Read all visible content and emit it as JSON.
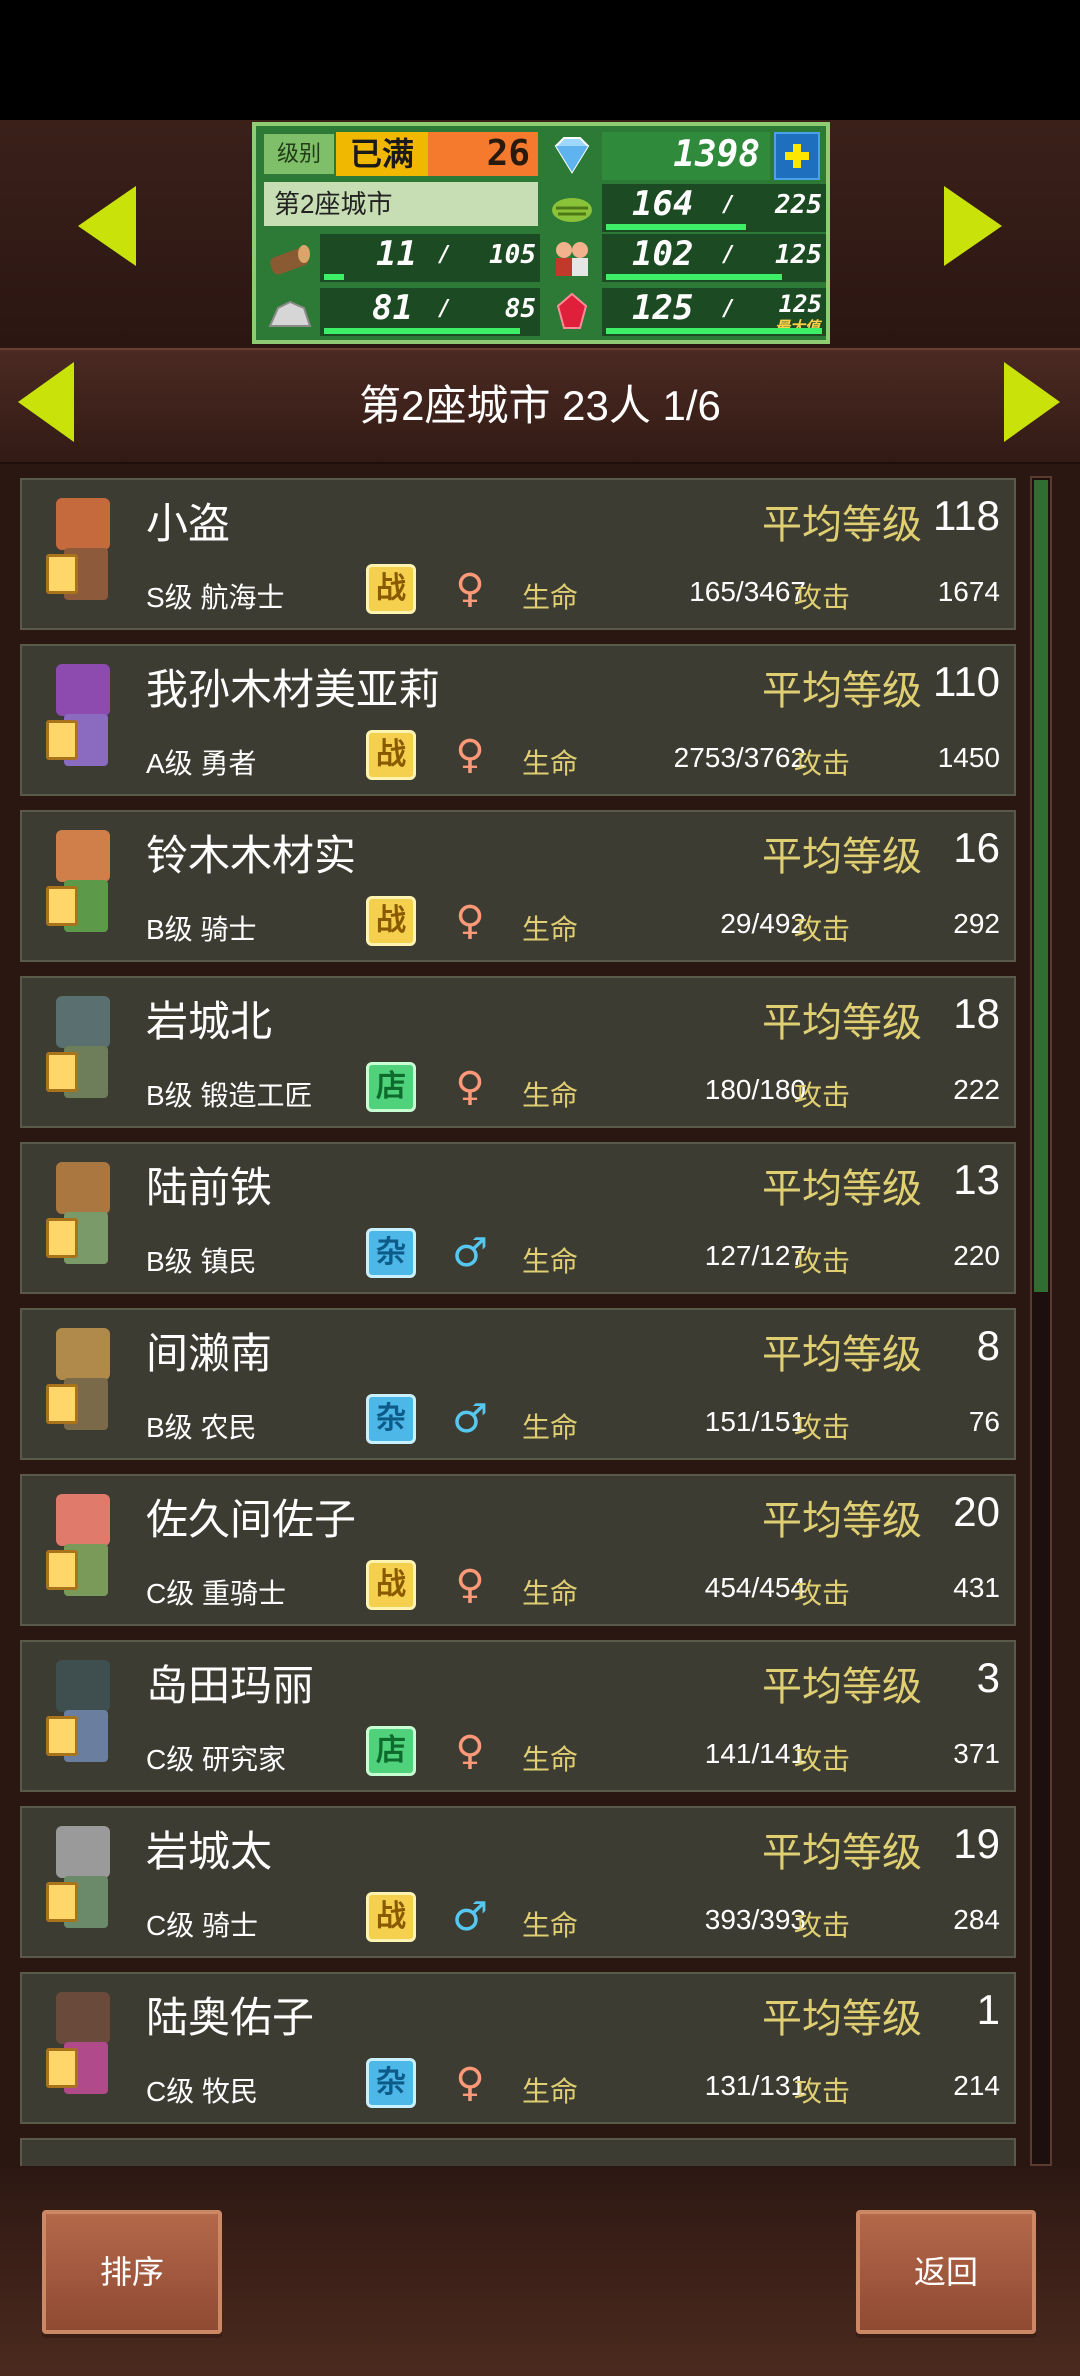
{
  "hud": {
    "level_label": "级别",
    "level_max": "已满",
    "level_value": "26",
    "gems": "1398",
    "city_name": "第2座城市",
    "food_value": "164",
    "food_max": "225",
    "wood_value": "11",
    "wood_max": "105",
    "pop_value": "102",
    "pop_max": "125",
    "stone_value": "81",
    "stone_max": "85",
    "ruby_value": "125",
    "ruby_max": "125",
    "max_tag": "最大值"
  },
  "header": {
    "title": "第2座城市  23人 1/6"
  },
  "columns": {
    "avg_level_label": "平均等级",
    "hp_label": "生命",
    "attack_label": "攻击"
  },
  "residents": [
    {
      "name": "小盗",
      "rank": "S级 航海士",
      "job_type": "战",
      "job_kind": "battle",
      "gender": "female",
      "hp": "165/3467",
      "attack": "1674",
      "level": "118",
      "head": "#c56a3c",
      "body": "#8d5a3b"
    },
    {
      "name": "我孙木材美亚莉",
      "rank": "A级 勇者",
      "job_type": "战",
      "job_kind": "battle",
      "gender": "female",
      "hp": "2753/3762",
      "attack": "1450",
      "level": "110",
      "head": "#8d4bb0",
      "body": "#8a6bbf"
    },
    {
      "name": "铃木木材实",
      "rank": "B级 骑士",
      "job_type": "战",
      "job_kind": "battle",
      "gender": "female",
      "hp": "29/492",
      "attack": "292",
      "level": "16",
      "head": "#d07e4a",
      "body": "#5c9a4a"
    },
    {
      "name": "岩城北",
      "rank": "B级 锻造工匠",
      "job_type": "店",
      "job_kind": "shop",
      "gender": "female",
      "hp": "180/180",
      "attack": "222",
      "level": "18",
      "head": "#5a6f6f",
      "body": "#6e7e5a"
    },
    {
      "name": "陆前铁",
      "rank": "B级 镇民",
      "job_type": "杂",
      "job_kind": "misc",
      "gender": "male",
      "hp": "127/127",
      "attack": "220",
      "level": "13",
      "head": "#a9773f",
      "body": "#7a9a6a"
    },
    {
      "name": "间濑南",
      "rank": "B级 农民",
      "job_type": "杂",
      "job_kind": "misc",
      "gender": "male",
      "hp": "151/151",
      "attack": "76",
      "level": "8",
      "head": "#b08a4a",
      "body": "#7a6a4a"
    },
    {
      "name": "佐久间佐子",
      "rank": "C级 重骑士",
      "job_type": "战",
      "job_kind": "battle",
      "gender": "female",
      "hp": "454/454",
      "attack": "431",
      "level": "20",
      "head": "#e07a6a",
      "body": "#7a9a5a"
    },
    {
      "name": "岛田玛丽",
      "rank": "C级 研究家",
      "job_type": "店",
      "job_kind": "shop",
      "gender": "female",
      "hp": "141/141",
      "attack": "371",
      "level": "3",
      "head": "#3f4f4f",
      "body": "#6a7fa0"
    },
    {
      "name": "岩城太",
      "rank": "C级 骑士",
      "job_type": "战",
      "job_kind": "battle",
      "gender": "male",
      "hp": "393/393",
      "attack": "284",
      "level": "19",
      "head": "#9a9a9a",
      "body": "#6a8a6a"
    },
    {
      "name": "陆奥佑子",
      "rank": "C级 牧民",
      "job_type": "杂",
      "job_kind": "misc",
      "gender": "female",
      "hp": "131/131",
      "attack": "214",
      "level": "1",
      "head": "#6a4a3a",
      "body": "#b04a8a"
    }
  ],
  "footer": {
    "sort_label": "排序",
    "back_label": "返回"
  }
}
